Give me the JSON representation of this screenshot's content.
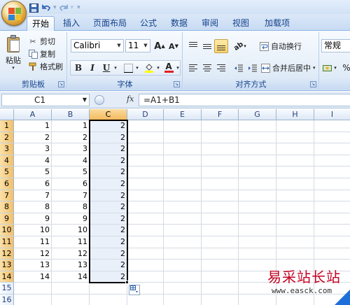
{
  "qat": {
    "save": "save-icon",
    "undo": "undo-icon",
    "redo": "redo-icon",
    "customize": "▾"
  },
  "tabs": [
    "开始",
    "插入",
    "页面布局",
    "公式",
    "数据",
    "审阅",
    "视图",
    "加载项"
  ],
  "active_tab": "开始",
  "clipboard": {
    "paste": "粘贴",
    "cut": "剪切",
    "copy": "复制",
    "format_painter": "格式刷",
    "group_label": "剪贴板"
  },
  "font": {
    "name": "Calibri",
    "size": "11",
    "bold": "B",
    "italic": "I",
    "underline": "U",
    "grow": "A",
    "shrink": "A",
    "font_color": "A",
    "group_label": "字体"
  },
  "alignment": {
    "wrap_text": "自动换行",
    "merge_center": "合并后居中",
    "group_label": "对齐方式"
  },
  "number": {
    "format": "常规",
    "percent": "%"
  },
  "formula_bar": {
    "name_box": "C1",
    "fx": "fx",
    "formula": "=A1+B1"
  },
  "columns": [
    "A",
    "B",
    "C",
    "D",
    "E",
    "F",
    "G",
    "H",
    "I"
  ],
  "selected_column": "C",
  "rows": [
    {
      "n": "1",
      "a": "1",
      "b": "1",
      "c": "2"
    },
    {
      "n": "2",
      "a": "2",
      "b": "2",
      "c": "2"
    },
    {
      "n": "3",
      "a": "3",
      "b": "3",
      "c": "2"
    },
    {
      "n": "4",
      "a": "4",
      "b": "4",
      "c": "2"
    },
    {
      "n": "5",
      "a": "5",
      "b": "5",
      "c": "2"
    },
    {
      "n": "6",
      "a": "6",
      "b": "6",
      "c": "2"
    },
    {
      "n": "7",
      "a": "7",
      "b": "7",
      "c": "2"
    },
    {
      "n": "8",
      "a": "8",
      "b": "8",
      "c": "2"
    },
    {
      "n": "9",
      "a": "9",
      "b": "9",
      "c": "2"
    },
    {
      "n": "10",
      "a": "10",
      "b": "10",
      "c": "2"
    },
    {
      "n": "11",
      "a": "11",
      "b": "11",
      "c": "2"
    },
    {
      "n": "12",
      "a": "12",
      "b": "12",
      "c": "2"
    },
    {
      "n": "13",
      "a": "13",
      "b": "13",
      "c": "2"
    },
    {
      "n": "14",
      "a": "14",
      "b": "14",
      "c": "2"
    },
    {
      "n": "15",
      "a": "",
      "b": "",
      "c": ""
    },
    {
      "n": "16",
      "a": "",
      "b": "",
      "c": ""
    }
  ],
  "watermark": {
    "title": "易采站长站",
    "url": "www.easck.com"
  }
}
